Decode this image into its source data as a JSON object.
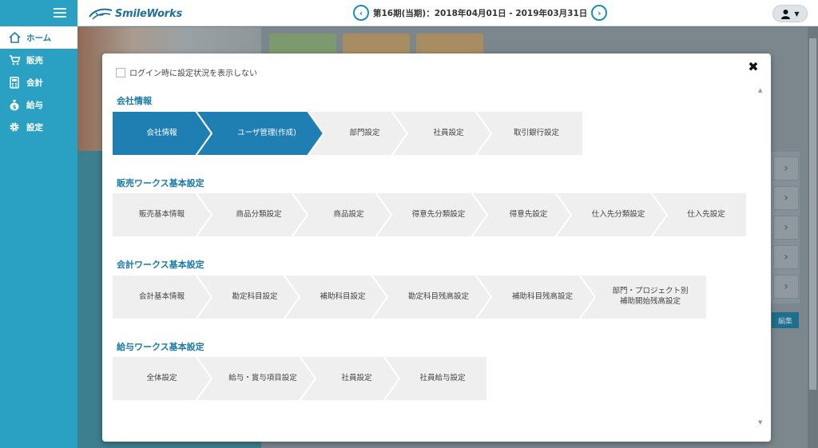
{
  "app": {
    "logo_text": "SmileWorks",
    "period_label": "第16期(当期)：2018年04月01日 - 2019年03月31日",
    "prev_icon": "chevron-left-circle-icon",
    "next_icon": "chevron-right-circle-icon",
    "user_icon": "user-icon"
  },
  "sidebar": {
    "items": [
      {
        "label": "ホーム",
        "icon": "home-icon",
        "active": true
      },
      {
        "label": "販売",
        "icon": "cart-icon",
        "active": false
      },
      {
        "label": "会計",
        "icon": "calculator-icon",
        "active": false
      },
      {
        "label": "給与",
        "icon": "money-bag-icon",
        "active": false
      },
      {
        "label": "設定",
        "icon": "gear-icon",
        "active": false
      }
    ]
  },
  "background": {
    "edit_label": "編集"
  },
  "modal": {
    "hide_checkbox_label": "ログイン時に設定状況を表示しない",
    "checked": false,
    "close_icon": "close-icon",
    "sections": [
      {
        "title": "会社情報",
        "steps": [
          "会社情報",
          "ユーザ管理(作成)",
          "部門設定",
          "社員設定",
          "取引銀行設定"
        ],
        "active_count": 2
      },
      {
        "title": "販売ワークス基本設定",
        "steps": [
          "販売基本情報",
          "商品分類設定",
          "商品設定",
          "得意先分類設定",
          "得意先設定",
          "仕入先分類設定",
          "仕入先設定"
        ],
        "active_count": 0
      },
      {
        "title": "会計ワークス基本設定",
        "steps": [
          "会計基本情報",
          "勘定科目設定",
          "補助科目設定",
          "勘定科目残高設定",
          "補助科目残高設定",
          "部門・プロジェクト別\n補助開始残高設定"
        ],
        "active_count": 0
      },
      {
        "title": "給与ワークス基本設定",
        "steps": [
          "全体設定",
          "給与・賞与項目設定",
          "社員設定",
          "社員給与設定"
        ],
        "active_count": 0
      }
    ]
  },
  "colors": {
    "brand": "#2aa0c3",
    "step_active": "#1f7fb2",
    "step_inactive": "#efefef",
    "section_title": "#1a7aa6"
  }
}
